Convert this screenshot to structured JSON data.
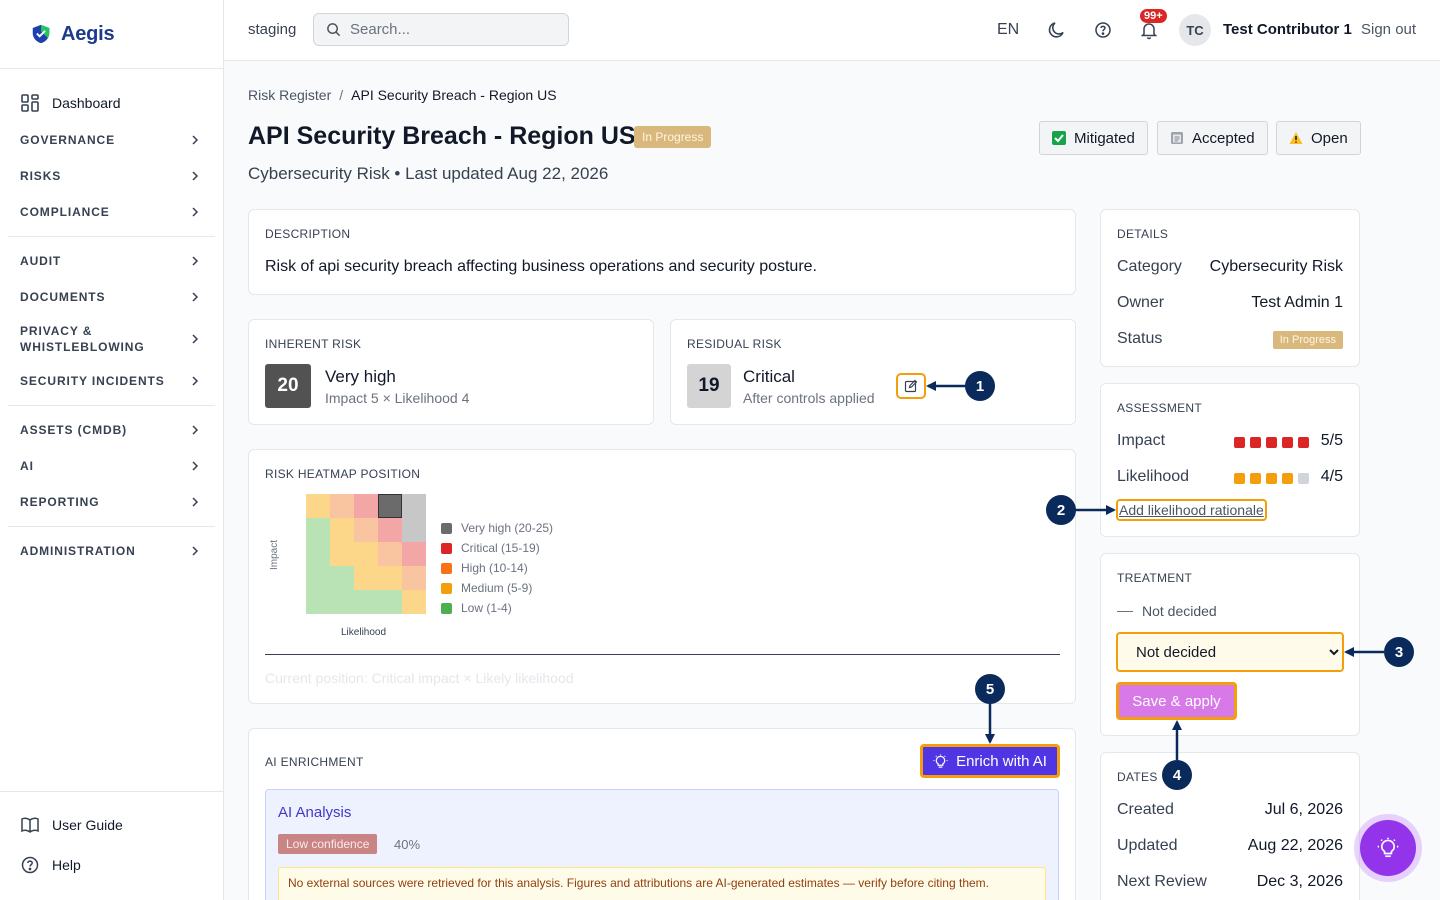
{
  "app": {
    "brand": "Aegis"
  },
  "sidebar": {
    "dashboard": "Dashboard",
    "groups": [
      [
        "GOVERNANCE",
        "RISKS",
        "COMPLIANCE"
      ],
      [
        "AUDIT",
        "DOCUMENTS",
        "PRIVACY & WHISTLEBLOWING",
        "SECURITY INCIDENTS"
      ],
      [
        "ASSETS (CMDB)",
        "AI",
        "REPORTING"
      ],
      [
        "ADMINISTRATION"
      ]
    ],
    "user_guide": "User Guide",
    "help": "Help"
  },
  "topbar": {
    "env": "staging",
    "search_placeholder": "Search...",
    "lang": "EN",
    "notif_count": "99+",
    "avatar_initials": "TC",
    "user_name": "Test Contributor 1",
    "sign_out": "Sign out"
  },
  "breadcrumb": {
    "parent": "Risk Register",
    "separator": "/",
    "current": "API Security Breach - Region US"
  },
  "page": {
    "title": "API Security Breach - Region US",
    "status_badge": "In Progress",
    "subtitle": "Cybersecurity Risk • Last updated Aug 22, 2026",
    "status_buttons": {
      "mitigated": "Mitigated",
      "accepted": "Accepted",
      "open": "Open"
    }
  },
  "description": {
    "label": "DESCRIPTION",
    "text": "Risk of api security breach affecting business operations and security posture."
  },
  "inherent": {
    "label": "INHERENT RISK",
    "score": "20",
    "level": "Very high",
    "detail": "Impact 5 × Likelihood 4"
  },
  "residual": {
    "label": "RESIDUAL RISK",
    "score": "19",
    "level": "Critical",
    "detail": "After controls applied"
  },
  "heatmap": {
    "label": "RISK HEATMAP POSITION",
    "y_label": "Impact",
    "x_label": "Likelihood",
    "legend": [
      {
        "label": "Very high (20-25)",
        "color": "#6b6b6b"
      },
      {
        "label": "Critical (15-19)",
        "color": "#dc2626"
      },
      {
        "label": "High (10-14)",
        "color": "#f97316"
      },
      {
        "label": "Medium (5-9)",
        "color": "#f59e0b"
      },
      {
        "label": "Low (1-4)",
        "color": "#4caf50"
      }
    ],
    "current_position": "Current position: Critical impact × Likely likelihood"
  },
  "details": {
    "label": "DETAILS",
    "category_key": "Category",
    "category_val": "Cybersecurity Risk",
    "owner_key": "Owner",
    "owner_val": "Test Admin 1",
    "status_key": "Status",
    "status_val": "In Progress"
  },
  "assessment": {
    "label": "ASSESSMENT",
    "impact_key": "Impact",
    "impact_val": "5/5",
    "impact_score": 5,
    "likelihood_key": "Likelihood",
    "likelihood_val": "4/5",
    "likelihood_score": 4,
    "impact_color": "#dc2626",
    "likelihood_color": "#f59e0b",
    "rationale_link": "Add likelihood rationale"
  },
  "treatment": {
    "label": "TREATMENT",
    "current": "Not decided",
    "select_value": "Not decided",
    "save_label": "Save & apply"
  },
  "dates": {
    "label": "DATES",
    "created_key": "Created",
    "created_val": "Jul 6, 2026",
    "updated_key": "Updated",
    "updated_val": "Aug 22, 2026",
    "review_key": "Next Review",
    "review_val": "Dec 3, 2026"
  },
  "ai": {
    "label": "AI ENRICHMENT",
    "button": "Enrich with AI",
    "analysis_title": "AI Analysis",
    "confidence": "Low confidence",
    "confidence_pct": "40%",
    "warning": "No external sources were retrieved for this analysis. Figures and attributions are AI-generated estimates — verify before citing them."
  },
  "markers": [
    "1",
    "2",
    "3",
    "4",
    "5"
  ]
}
